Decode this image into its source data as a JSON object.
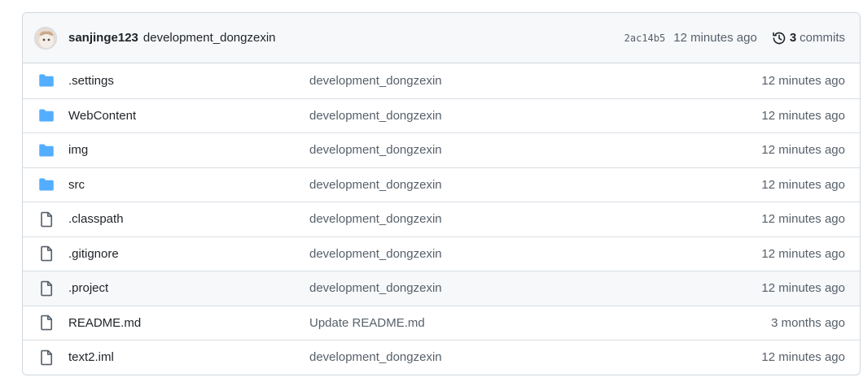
{
  "latest_commit": {
    "author": "sanjinge123",
    "message": "development_dongzexin",
    "sha": "2ac14b5",
    "time": "12 minutes ago",
    "commits_count": "3",
    "commits_label": "commits"
  },
  "files": [
    {
      "type": "folder",
      "name": ".settings",
      "message": "development_dongzexin",
      "time": "12 minutes ago"
    },
    {
      "type": "folder",
      "name": "WebContent",
      "message": "development_dongzexin",
      "time": "12 minutes ago"
    },
    {
      "type": "folder",
      "name": "img",
      "message": "development_dongzexin",
      "time": "12 minutes ago"
    },
    {
      "type": "folder",
      "name": "src",
      "message": "development_dongzexin",
      "time": "12 minutes ago"
    },
    {
      "type": "file",
      "name": ".classpath",
      "message": "development_dongzexin",
      "time": "12 minutes ago"
    },
    {
      "type": "file",
      "name": ".gitignore",
      "message": "development_dongzexin",
      "time": "12 minutes ago"
    },
    {
      "type": "file",
      "name": ".project",
      "message": "development_dongzexin",
      "time": "12 minutes ago"
    },
    {
      "type": "file",
      "name": "README.md",
      "message": "Update README.md",
      "time": "3 months ago"
    },
    {
      "type": "file",
      "name": "text2.iml",
      "message": "development_dongzexin",
      "time": "12 minutes ago"
    }
  ],
  "colors": {
    "folder": "#54aeff",
    "file": "#57606a",
    "border": "#d0d7de",
    "header_bg": "#f6f8fa"
  }
}
